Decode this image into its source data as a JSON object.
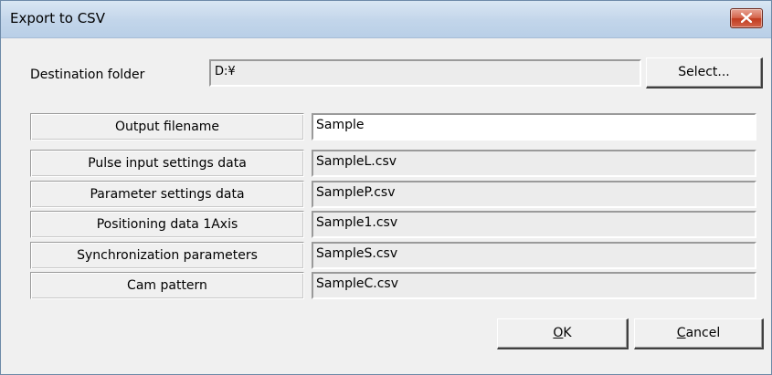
{
  "window": {
    "title": "Export to CSV",
    "close_icon": "close-x-icon"
  },
  "destination": {
    "label": "Destination folder",
    "value": "D:¥",
    "select_label": "Select..."
  },
  "rows": [
    {
      "label": "Output filename",
      "value": "Sample",
      "editable": true
    },
    {
      "label": "Pulse input settings data",
      "value": "SampleL.csv",
      "editable": false
    },
    {
      "label": "Parameter settings data",
      "value": "SampleP.csv",
      "editable": false
    },
    {
      "label": "Positioning data 1Axis",
      "value": "Sample1.csv",
      "editable": false
    },
    {
      "label": "Synchronization parameters",
      "value": "SampleS.csv",
      "editable": false
    },
    {
      "label": "Cam pattern",
      "value": "SampleC.csv",
      "editable": false
    }
  ],
  "buttons": {
    "ok_mnemonic": "O",
    "ok_rest": "K",
    "cancel_mnemonic": "C",
    "cancel_rest": "ancel"
  },
  "colors": {
    "close_button": "#c9452b",
    "titlebar": "#c2d5ea",
    "dialog_bg": "#f0f0f0"
  }
}
